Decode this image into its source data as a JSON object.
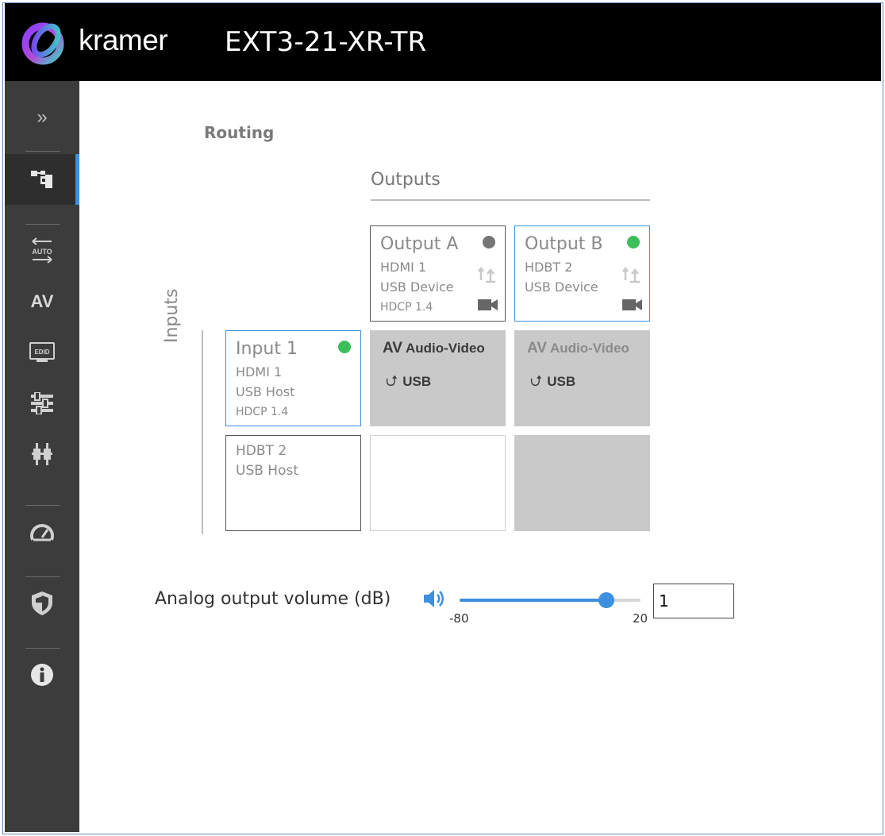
{
  "header": {
    "brand": "kramer",
    "device_name": "EXT3-21-XR-TR"
  },
  "sidebar": {
    "expand_icon": "double-chevron-right-icon",
    "items": [
      {
        "id": "routing",
        "icon": "routing-icon",
        "active": true
      },
      {
        "id": "auto-switching",
        "icon": "auto-switch-icon",
        "label": "AUTO"
      },
      {
        "id": "av",
        "icon": "av-text-icon",
        "label": "AV"
      },
      {
        "id": "edid",
        "icon": "edid-icon",
        "label": "EDID"
      },
      {
        "id": "device-settings",
        "icon": "settings-sliders-icon"
      },
      {
        "id": "connectors",
        "icon": "connector-plug-icon"
      },
      {
        "id": "diagnostics",
        "icon": "gauge-icon"
      },
      {
        "id": "security",
        "icon": "shield-icon"
      },
      {
        "id": "about",
        "icon": "info-icon"
      }
    ]
  },
  "routing": {
    "title": "Routing",
    "outputs_label": "Outputs",
    "inputs_label": "Inputs",
    "outputs": [
      {
        "name": "Output A",
        "line1": "HDMI 1",
        "line2": "USB Device",
        "line3": "HDCP 1.4",
        "status": "inactive",
        "status_color": "#757575"
      },
      {
        "name": "Output B",
        "line1": "HDBT 2",
        "line2": "USB Device",
        "line3": "",
        "status": "active",
        "status_color": "#3cbf5a"
      }
    ],
    "inputs": [
      {
        "name": "Input 1",
        "line1": "HDMI 1",
        "line2": "USB Host",
        "line3": "HDCP 1.4",
        "status": "active",
        "status_color": "#3cbf5a",
        "selected": true
      },
      {
        "name": "",
        "line1": "HDBT 2",
        "line2": "USB Host",
        "line3": "",
        "selected": false
      }
    ],
    "crosspoints": {
      "av_badge": "AV",
      "av_label": "Audio-Video",
      "usb_label": "USB"
    }
  },
  "volume": {
    "label": "Analog output volume (dB)",
    "min": -80,
    "max": 20,
    "min_label": "-80",
    "max_label": "20",
    "value": 1,
    "value_text": "1"
  },
  "colors": {
    "accent": "#3d8fe0",
    "status_green": "#3cbf5a",
    "status_gray": "#757575",
    "sidebar_bg": "#3c3c3c",
    "header_bg": "#000000"
  }
}
